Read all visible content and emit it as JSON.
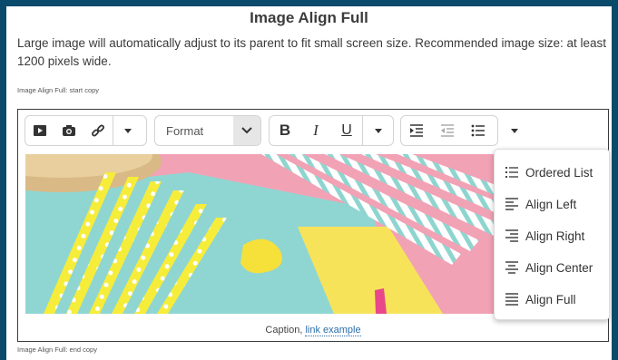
{
  "page": {
    "title": "Image Align Full",
    "description": "Large image will automatically adjust to its parent to fit small screen size. Recommended image size: at least 1200 pixels wide.",
    "copy_start": "Image Align Full: start copy",
    "copy_end": "Image Align Full: end copy"
  },
  "toolbar": {
    "media_icons": [
      "video-icon",
      "camera-icon",
      "link-icon"
    ],
    "format_label": "Format",
    "text_buttons": {
      "bold": "B",
      "italic": "I",
      "underline": "U"
    },
    "list_icons": [
      "indent-icon",
      "outdent-icon",
      "bullet-list-icon"
    ]
  },
  "caption": {
    "text": "Caption, ",
    "link": "link example"
  },
  "dropdown": {
    "items": [
      {
        "label": "Ordered List",
        "icon": "ordered-list-icon"
      },
      {
        "label": "Align Left",
        "icon": "align-left-icon"
      },
      {
        "label": "Align Right",
        "icon": "align-right-icon"
      },
      {
        "label": "Align Center",
        "icon": "align-center-icon"
      },
      {
        "label": "Align Full",
        "icon": "align-full-icon"
      }
    ]
  },
  "colors": {
    "frame": "#0a4a6a",
    "editor_border": "#3b3b3b",
    "link": "#2b6ea8"
  }
}
